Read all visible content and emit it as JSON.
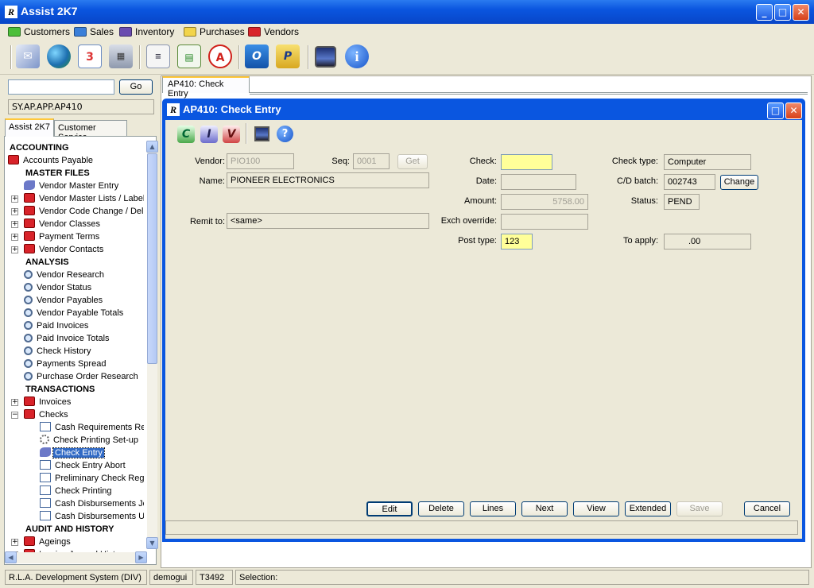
{
  "app": {
    "title": "Assist 2K7",
    "icon_text": "R"
  },
  "menu": [
    {
      "label": "Customers",
      "color": "#4cbf3a"
    },
    {
      "label": "Sales",
      "color": "#3a7fd9"
    },
    {
      "label": "Inventory",
      "color": "#6a4cb0"
    },
    {
      "label": "Purchases",
      "color": "#f2d44a"
    },
    {
      "label": "Vendors",
      "color": "#d8232a"
    }
  ],
  "toolbar": {
    "icons": [
      "mail-icon",
      "globe-icon",
      "calendar-icon",
      "calculator-icon",
      "document-icon",
      "sheet-icon",
      "acrobat-icon",
      "outlook-icon",
      "publisher-icon",
      "picture-icon",
      "info-icon"
    ],
    "calendar_text": "3",
    "outlook_text": "O",
    "publisher_text": "P",
    "info_text": "i"
  },
  "left": {
    "search_value": "",
    "go_label": "Go",
    "path": "SY.AP.APP.AP410",
    "tabs": [
      "Assist 2K7",
      "Customer Service"
    ],
    "tree": [
      {
        "label": "ACCOUNTING",
        "type": "header",
        "level": 0
      },
      {
        "label": "Accounts Payable",
        "icon": "folder",
        "level": 0
      },
      {
        "label": "MASTER FILES",
        "type": "header",
        "level": 1
      },
      {
        "label": "Vendor Master Entry",
        "icon": "pen",
        "level": 1
      },
      {
        "label": "Vendor Master Lists / Labels",
        "icon": "folder",
        "level": 1,
        "pm": "+"
      },
      {
        "label": "Vendor Code Change / Delete",
        "icon": "folder",
        "level": 1,
        "pm": "+"
      },
      {
        "label": "Vendor Classes",
        "icon": "folder",
        "level": 1,
        "pm": "+"
      },
      {
        "label": "Payment Terms",
        "icon": "folder",
        "level": 1,
        "pm": "+"
      },
      {
        "label": "Vendor Contacts",
        "icon": "folder",
        "level": 1,
        "pm": "+"
      },
      {
        "label": "ANALYSIS",
        "type": "header",
        "level": 1
      },
      {
        "label": "Vendor Research",
        "icon": "search",
        "level": 1
      },
      {
        "label": "Vendor Status",
        "icon": "search",
        "level": 1
      },
      {
        "label": "Vendor Payables",
        "icon": "search",
        "level": 1
      },
      {
        "label": "Vendor Payable Totals",
        "icon": "search",
        "level": 1
      },
      {
        "label": "Paid Invoices",
        "icon": "search",
        "level": 1
      },
      {
        "label": "Paid Invoice Totals",
        "icon": "search",
        "level": 1
      },
      {
        "label": "Check History",
        "icon": "search",
        "level": 1
      },
      {
        "label": "Payments Spread",
        "icon": "search",
        "level": 1
      },
      {
        "label": "Purchase Order Research",
        "icon": "search",
        "level": 1
      },
      {
        "label": "TRANSACTIONS",
        "type": "header",
        "level": 1
      },
      {
        "label": "Invoices",
        "icon": "folder",
        "level": 1,
        "pm": "+"
      },
      {
        "label": "Checks",
        "icon": "folder",
        "level": 1,
        "pm": "-"
      },
      {
        "label": "Cash Requirements Report",
        "icon": "doc",
        "level": 2
      },
      {
        "label": "Check Printing Set-up",
        "icon": "gear",
        "level": 2
      },
      {
        "label": "Check Entry",
        "icon": "pen",
        "level": 2,
        "selected": true
      },
      {
        "label": "Check Entry Abort",
        "icon": "doc",
        "level": 2
      },
      {
        "label": "Preliminary Check Register",
        "icon": "doc",
        "level": 2
      },
      {
        "label": "Check Printing",
        "icon": "doc",
        "level": 2
      },
      {
        "label": "Cash Disbursements Journal",
        "icon": "doc",
        "level": 2
      },
      {
        "label": "Cash Disbursements Update",
        "icon": "doc",
        "level": 2
      },
      {
        "label": "AUDIT AND HISTORY",
        "type": "header",
        "level": 1
      },
      {
        "label": "Ageings",
        "icon": "folder",
        "level": 1,
        "pm": "+"
      },
      {
        "label": "Invoice Journal History",
        "icon": "folder",
        "level": 1,
        "pm": "+"
      }
    ]
  },
  "content_tab": "AP410: Check Entry",
  "inner": {
    "title": "AP410: Check Entry",
    "toolbar": [
      "C",
      "I",
      "V"
    ],
    "help_text": "?",
    "labels": {
      "vendor": "Vendor:",
      "seq": "Seq:",
      "name": "Name:",
      "remit": "Remit to:",
      "check": "Check:",
      "date": "Date:",
      "amount": "Amount:",
      "exch": "Exch override:",
      "post_type": "Post type:",
      "check_type": "Check type:",
      "cd_batch": "C/D batch:",
      "status": "Status:",
      "to_apply": "To apply:"
    },
    "values": {
      "vendor": "PIO100",
      "seq": "0001",
      "get": "Get",
      "name": "PIONEER ELECTRONICS",
      "remit": "<same>",
      "check": "",
      "date": "",
      "amount": "5758.00",
      "exch": "",
      "post_type": "123",
      "check_type": "Computer",
      "cd_batch": "002743",
      "change": "Change",
      "status": "PEND",
      "to_apply": ".00"
    },
    "buttons": [
      "Edit",
      "Delete",
      "Lines",
      "Next",
      "View",
      "Extended",
      "Save",
      "Cancel"
    ]
  },
  "status": [
    "R.L.A. Development System (DIV)",
    "demogui",
    "T3492",
    "Selection:"
  ]
}
